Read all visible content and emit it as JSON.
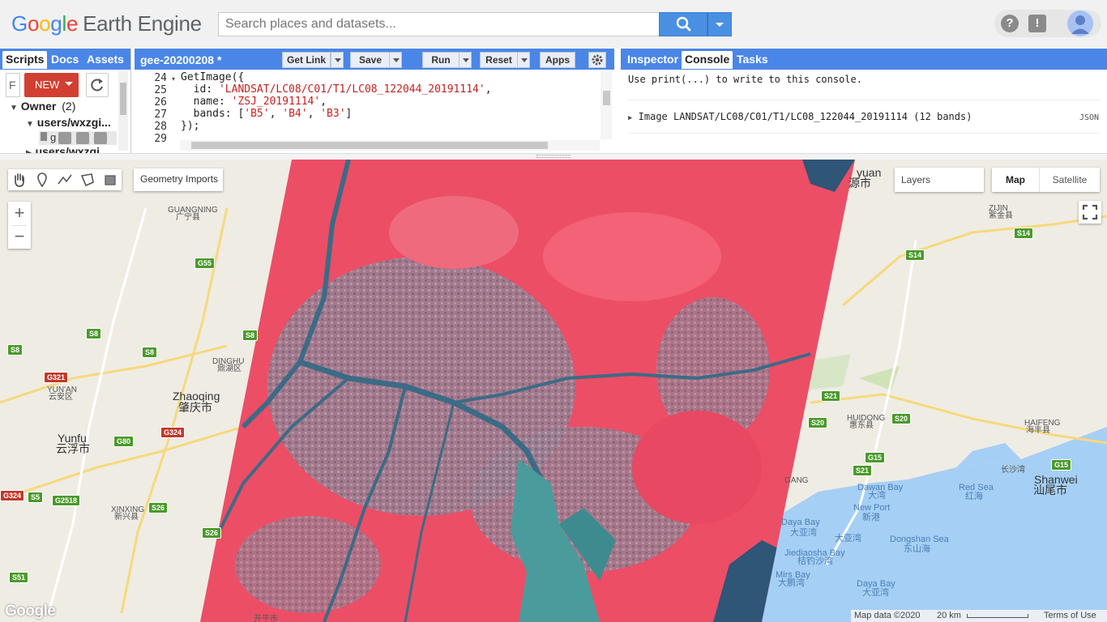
{
  "app": {
    "logo_letters": [
      "G",
      "o",
      "o",
      "g",
      "l",
      "e"
    ],
    "logo_suffix": "Earth Engine",
    "search_placeholder": "Search places and datasets..."
  },
  "left_panel": {
    "tabs": [
      "Scripts",
      "Docs",
      "Assets"
    ],
    "filter_value": "F",
    "new_button": "NEW",
    "owner_label": "Owner",
    "owner_count": "(2)",
    "repo_1": "users/wxzgi...",
    "repo_2": "users/wxzgi",
    "file_1": "g"
  },
  "code_panel": {
    "file_title": "gee-20200208 *",
    "buttons": {
      "get_link": "Get Link",
      "save": "Save",
      "run": "Run",
      "reset": "Reset",
      "apps": "Apps"
    },
    "line_numbers": [
      "24",
      "25",
      "26",
      "27",
      "28",
      "29"
    ],
    "lines": [
      [
        {
          "t": "GetImage({",
          "c": "#222"
        }
      ],
      [
        {
          "t": "  id: ",
          "c": "#222"
        },
        {
          "t": "'LANDSAT/LC08/C01/T1/LC08_122044_20191114'",
          "c": "#c5221f"
        },
        {
          "t": ",",
          "c": "#222"
        }
      ],
      [
        {
          "t": "  name: ",
          "c": "#222"
        },
        {
          "t": "'ZSJ_20191114'",
          "c": "#c5221f"
        },
        {
          "t": ",",
          "c": "#222"
        }
      ],
      [
        {
          "t": "  bands: [",
          "c": "#222"
        },
        {
          "t": "'B5'",
          "c": "#c5221f"
        },
        {
          "t": ", ",
          "c": "#222"
        },
        {
          "t": "'B4'",
          "c": "#c5221f"
        },
        {
          "t": ", ",
          "c": "#222"
        },
        {
          "t": "'B3'",
          "c": "#c5221f"
        },
        {
          "t": "]",
          "c": "#222"
        }
      ],
      [
        {
          "t": "});",
          "c": "#222"
        }
      ],
      [
        {
          "t": "",
          "c": "#222"
        }
      ]
    ]
  },
  "right_panel": {
    "tabs": [
      "Inspector",
      "Console",
      "Tasks"
    ],
    "console_hint": "Use print(...) to write to this console.",
    "console_entry": "Image LANDSAT/LC08/C01/T1/LC08_122044_20191114 (12 bands)",
    "json_label": "JSON"
  },
  "map": {
    "geometry_imports": "Geometry Imports",
    "layers": "Layers",
    "map_btn": "Map",
    "satellite_btn": "Satellite",
    "zoom_in": "+",
    "zoom_out": "−",
    "attribution": "Map data ©2020",
    "scale": "20 km",
    "terms": "Terms of Use",
    "google_watermark": "Google",
    "labels": [
      {
        "t": "GUANGNING",
        "cls": "",
        "name": "label-guangning"
      },
      {
        "t": "广宁县",
        "cls": "",
        "name": "label-guangning-cn"
      },
      {
        "t": "DINGHU",
        "cls": "",
        "name": "label-dinghu"
      },
      {
        "t": "鼎湖区",
        "cls": "",
        "name": "label-dinghu-cn"
      },
      {
        "t": "YUN'AN",
        "cls": "",
        "name": "label-yunan"
      },
      {
        "t": "云安区",
        "cls": "",
        "name": "label-yunan-cn"
      },
      {
        "t": "Zhaoqing",
        "cls": "big",
        "name": "label-zhaoqing"
      },
      {
        "t": "肇庆市",
        "cls": "big",
        "name": "label-zhaoqing-cn"
      },
      {
        "t": "Yunfu",
        "cls": "big",
        "name": "label-yunfu"
      },
      {
        "t": "云浮市",
        "cls": "big",
        "name": "label-yunfu-cn"
      },
      {
        "t": "XINXING",
        "cls": "",
        "name": "label-xinxing"
      },
      {
        "t": "新兴县",
        "cls": "",
        "name": "label-xinxing-cn"
      },
      {
        "t": "开平市",
        "cls": "",
        "name": "label-kaiping-cn"
      },
      {
        "t": "yuan",
        "cls": "big",
        "name": "label-heyuan"
      },
      {
        "t": "源市",
        "cls": "big",
        "name": "label-heyuan-cn"
      },
      {
        "t": "ZIJIN",
        "cls": "",
        "name": "label-zijin"
      },
      {
        "t": "紫金县",
        "cls": "",
        "name": "label-zijin-cn"
      },
      {
        "t": "HUIDONG",
        "cls": "",
        "name": "label-huidong"
      },
      {
        "t": "惠东县",
        "cls": "",
        "name": "label-huidong-cn"
      },
      {
        "t": "HAIFENG",
        "cls": "",
        "name": "label-haifeng"
      },
      {
        "t": "海丰县",
        "cls": "",
        "name": "label-haifeng-cn"
      },
      {
        "t": "长沙湾",
        "cls": "",
        "name": "label-changshawan-cn"
      },
      {
        "t": "Shanwei",
        "cls": "big",
        "name": "label-shanwei"
      },
      {
        "t": "汕尾市",
        "cls": "big",
        "name": "label-shanwei-cn"
      },
      {
        "t": "GANG",
        "cls": "",
        "name": "label-gang"
      },
      {
        "t": "Dawan Bay",
        "cls": "water",
        "name": "label-dawan-bay"
      },
      {
        "t": "大湾",
        "cls": "water",
        "name": "label-dawan-bay-cn"
      },
      {
        "t": "Red Sea",
        "cls": "water",
        "name": "label-red-sea"
      },
      {
        "t": "红海",
        "cls": "water",
        "name": "label-red-sea-cn"
      },
      {
        "t": "New Port",
        "cls": "water",
        "name": "label-new-port"
      },
      {
        "t": "新港",
        "cls": "water",
        "name": "label-new-port-cn"
      },
      {
        "t": "Daya Bay",
        "cls": "water",
        "name": "label-daya-bay"
      },
      {
        "t": "大亚湾",
        "cls": "water",
        "name": "label-daya-bay-cn"
      },
      {
        "t": "大亚湾",
        "cls": "water",
        "name": "label-daya-bay-cn-2"
      },
      {
        "t": "Dongshan Sea",
        "cls": "water",
        "name": "label-dongshan-sea"
      },
      {
        "t": "东山海",
        "cls": "water",
        "name": "label-dongshan-sea-cn"
      },
      {
        "t": "Jiediaosha Bay",
        "cls": "water",
        "name": "label-jiediaosha-bay"
      },
      {
        "t": "桔钓沙湾",
        "cls": "water",
        "name": "label-jiediaosha-bay-cn"
      },
      {
        "t": "Mirs Bay",
        "cls": "water",
        "name": "label-mirs-bay"
      },
      {
        "t": "大鹏湾",
        "cls": "water",
        "name": "label-mirs-bay-cn"
      },
      {
        "t": "Daya Bay",
        "cls": "water",
        "name": "label-daya-bay-2"
      },
      {
        "t": "大亚湾",
        "cls": "water",
        "name": "label-daya-bay-2-cn"
      }
    ],
    "shields": [
      {
        "t": "G55",
        "red": false,
        "name": "shield-g55"
      },
      {
        "t": "S8",
        "red": false,
        "name": "shield-s8-a"
      },
      {
        "t": "S8",
        "red": false,
        "name": "shield-s8-b"
      },
      {
        "t": "S8",
        "red": false,
        "name": "shield-s8-c"
      },
      {
        "t": "S8",
        "red": false,
        "name": "shield-s8-d"
      },
      {
        "t": "G321",
        "red": true,
        "name": "shield-g321"
      },
      {
        "t": "G80",
        "red": false,
        "name": "shield-g80"
      },
      {
        "t": "G324",
        "red": true,
        "name": "shield-g324"
      },
      {
        "t": "G324",
        "red": true,
        "name": "shield-g324-edge"
      },
      {
        "t": "S5",
        "red": false,
        "name": "shield-s5"
      },
      {
        "t": "G2518",
        "red": false,
        "name": "shield-g2518"
      },
      {
        "t": "S26",
        "red": false,
        "name": "shield-s26"
      },
      {
        "t": "S26",
        "red": false,
        "name": "shield-s26-b"
      },
      {
        "t": "S51",
        "red": false,
        "name": "shield-s51"
      },
      {
        "t": "S14",
        "red": false,
        "name": "shield-s14-a"
      },
      {
        "t": "S14",
        "red": false,
        "name": "shield-s14-b"
      },
      {
        "t": "S21",
        "red": false,
        "name": "shield-s21-a"
      },
      {
        "t": "S20",
        "red": false,
        "name": "shield-s20-a"
      },
      {
        "t": "S20",
        "red": false,
        "name": "shield-s20-b"
      },
      {
        "t": "G15",
        "red": false,
        "name": "shield-g15-a"
      },
      {
        "t": "S21",
        "red": false,
        "name": "shield-s21-b"
      },
      {
        "t": "G15",
        "red": false,
        "name": "shield-g15-b"
      }
    ]
  },
  "colors": {
    "accent": "#4a86e8",
    "search_button": "#4a90e2",
    "new_button": "#d23f31",
    "string_literal": "#c5221f",
    "image_vegetation": "#e8405a",
    "water": "#a6cff5",
    "land": "#efece4"
  }
}
